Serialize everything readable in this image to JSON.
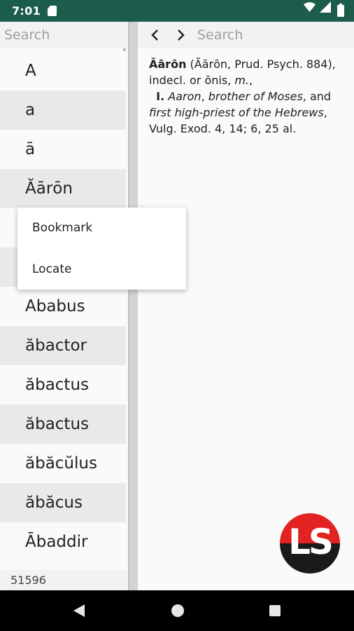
{
  "status_bar": {
    "time": "7:01",
    "icons": [
      "sd-card-icon",
      "wifi-icon",
      "signal-icon",
      "battery-icon"
    ]
  },
  "left_pane": {
    "search_placeholder": "Search",
    "items": [
      {
        "label": "A"
      },
      {
        "label": "a"
      },
      {
        "label": "ā"
      },
      {
        "label": "Ăārōn"
      },
      {
        "label": ""
      },
      {
        "label": ""
      },
      {
        "label": "Ababus"
      },
      {
        "label": "ăbactor"
      },
      {
        "label": "ăbactus"
      },
      {
        "label": "ăbactus"
      },
      {
        "label": "ăbăcŭlus"
      },
      {
        "label": "ăbăcus"
      },
      {
        "label": "Ābaddir"
      }
    ],
    "count": "51596"
  },
  "right_pane": {
    "search_placeholder": "Search",
    "back_icon": "chevron-left-icon",
    "forward_icon": "chevron-right-icon",
    "entry": {
      "headword": "Ăārōn",
      "variant": " (Ăārōn, Prud. Psych. 884),",
      "grammar_a": "indecl. or ōnis, ",
      "gender": "m.",
      "grammar_b": ",",
      "sense_num": "I.",
      "gloss_a": "Aaron",
      "gloss_b": ", ",
      "gloss_c": "brother of Moses",
      "gloss_d": ", and",
      "gloss_e": "first high-priest of the Hebrews",
      "gloss_f": ",",
      "citation": "Vulg. Exod. 4, 14; 6, 25 al."
    },
    "logo_text": "LS"
  },
  "popup_menu": {
    "items": [
      {
        "label": "Bookmark"
      },
      {
        "label": "Locate"
      }
    ]
  },
  "colors": {
    "status_bar": "#1c5c4a",
    "logo_red": "#e32222",
    "logo_black": "#1a1a1a",
    "list_alt_row": "#e9e9e9"
  }
}
